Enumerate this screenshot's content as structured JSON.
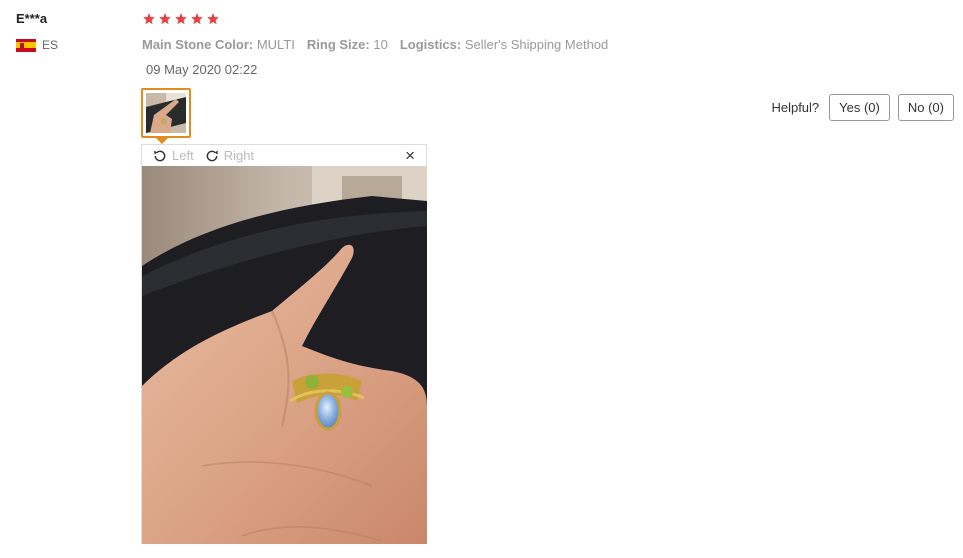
{
  "reviewer": {
    "name": "E***a",
    "country_code": "ES",
    "flag_icon": "spain-flag-icon"
  },
  "rating": {
    "stars": 5,
    "max": 5,
    "color": "#e64545"
  },
  "attributes": [
    {
      "label": "Main Stone Color:",
      "value": "MULTI"
    },
    {
      "label": "Ring Size:",
      "value": "10"
    },
    {
      "label": "Logistics:",
      "value": "Seller's Shipping Method"
    }
  ],
  "date": "09 May 2020 02:22",
  "helpful": {
    "label": "Helpful?",
    "yes": "Yes (0)",
    "no": "No (0)"
  },
  "viewer": {
    "rotate_left": "Left",
    "rotate_right": "Right",
    "close_icon": "×"
  },
  "colors": {
    "accent": "#e08c1e",
    "star": "#e64545"
  }
}
